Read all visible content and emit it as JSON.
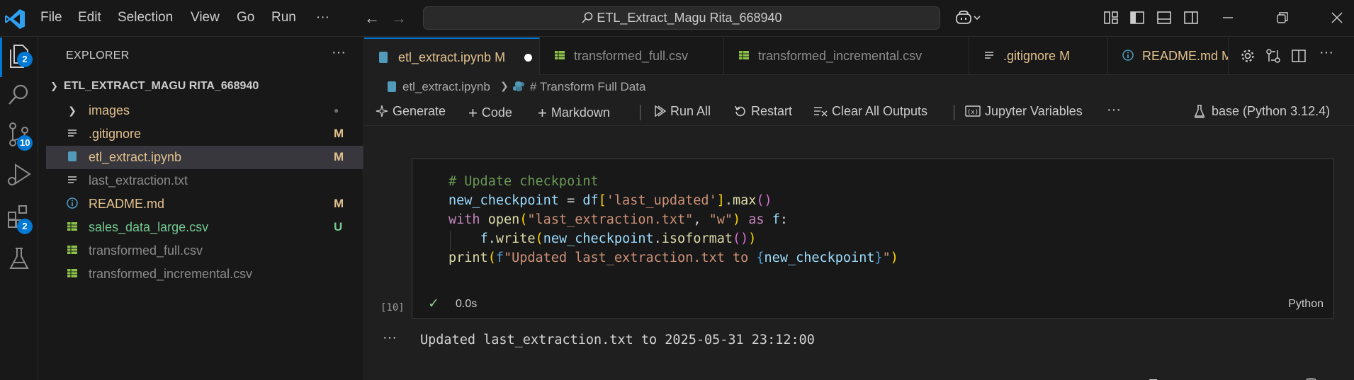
{
  "titlebar": {
    "menus": [
      "File",
      "Edit",
      "Selection",
      "View",
      "Go",
      "Run",
      "···"
    ],
    "search": "ETL_Extract_Magu Rita_668940"
  },
  "activity": {
    "explorer_badge": "2",
    "scm_badge": "10",
    "extensions_badge": "2"
  },
  "sidebar": {
    "title": "EXPLORER",
    "more": "···",
    "root": "ETL_EXTRACT_MAGU RITA_668940",
    "items": [
      {
        "label": "images",
        "status": "●",
        "color": "#e2c08d",
        "status_color": "#6e6e6e",
        "icon": "chevron-right-icon"
      },
      {
        "label": ".gitignore",
        "status": "M",
        "color": "#e2c08d",
        "status_color": "#e2c08d",
        "icon": "lines-icon"
      },
      {
        "label": "etl_extract.ipynb",
        "status": "M",
        "color": "#e2c08d",
        "status_color": "#e2c08d",
        "icon": "notebook-icon"
      },
      {
        "label": "last_extraction.txt",
        "status": "",
        "color": "#8b8b8b",
        "status_color": "#8b8b8b",
        "icon": "lines-icon"
      },
      {
        "label": "README.md",
        "status": "M",
        "color": "#e2c08d",
        "status_color": "#e2c08d",
        "icon": "info-icon"
      },
      {
        "label": "sales_data_large.csv",
        "status": "U",
        "color": "#73c991",
        "status_color": "#73c991",
        "icon": "table-icon"
      },
      {
        "label": "transformed_full.csv",
        "status": "",
        "color": "#8b8b8b",
        "status_color": "#8b8b8b",
        "icon": "table-icon"
      },
      {
        "label": "transformed_incremental.csv",
        "status": "",
        "color": "#8b8b8b",
        "status_color": "#8b8b8b",
        "icon": "table-icon"
      }
    ]
  },
  "tabs": [
    {
      "label": "etl_extract.ipynb",
      "suffix": "M",
      "color": "#e2c08d"
    },
    {
      "label": "transformed_full.csv",
      "suffix": "",
      "color": "#8b8b8b"
    },
    {
      "label": "transformed_incremental.csv",
      "suffix": "",
      "color": "#8b8b8b"
    },
    {
      "label": ".gitignore",
      "suffix": "M",
      "color": "#e2c08d"
    },
    {
      "label": "README.md",
      "suffix": "M",
      "color": "#e2c08d"
    }
  ],
  "breadcrumb": {
    "file": "etl_extract.ipynb",
    "section": "# Transform Full Data"
  },
  "toolbar": {
    "generate": "Generate",
    "code": "Code",
    "markdown": "Markdown",
    "run_all": "Run All",
    "restart": "Restart",
    "clear_outputs": "Clear All Outputs",
    "jupyter_vars": "Jupyter Variables",
    "more": "···",
    "kernel": "base (Python 3.12.4)"
  },
  "cell": {
    "exec_count": "[10]",
    "duration": "0.0s",
    "language": "Python",
    "output_more": "···",
    "output": "Updated last_extraction.txt to 2025-05-31 23:12:00"
  },
  "colors": {
    "accent": "#0078d4",
    "modified": "#e2c08d",
    "untracked": "#73c991",
    "success": "#89d185"
  }
}
